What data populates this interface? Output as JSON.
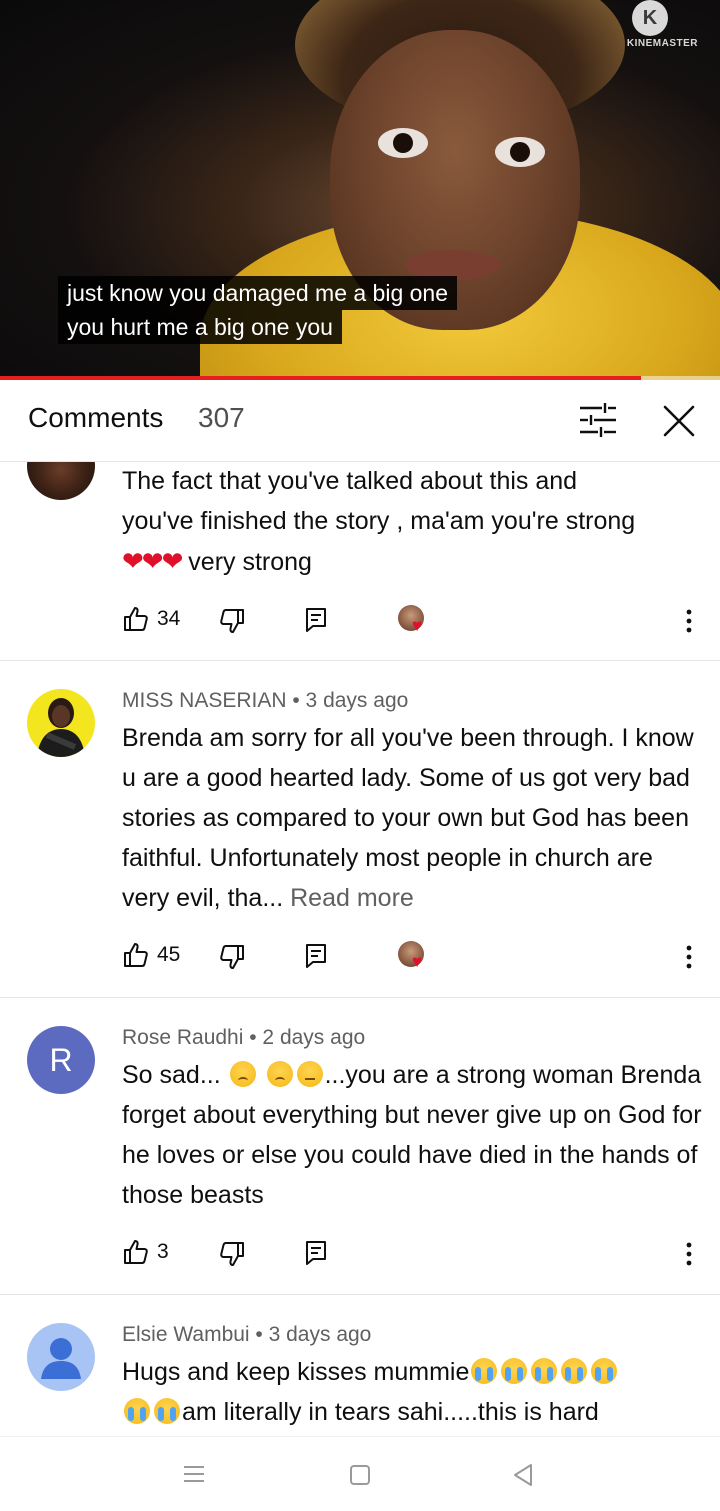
{
  "video": {
    "watermark_text": "KINEMASTER",
    "watermark_logo": "K",
    "caption_line1": "just know you damaged me a big one",
    "caption_line2": "you hurt me a big one you",
    "progress_fraction": 0.89
  },
  "header": {
    "title": "Comments",
    "count": "307",
    "filter_icon": "sliders-icon",
    "close_icon": "close-icon"
  },
  "comments": [
    {
      "author_meta": "",
      "text_line1": "The fact that you've talked about this and",
      "text_line2": "you've finished the story , ma'am you're strong",
      "hearts": "❤❤❤",
      "text_tail": " very strong",
      "likes": "34",
      "creator_hearted": true
    },
    {
      "author_meta": "MISS NASERIAN • 3 days ago",
      "text": "Brenda am sorry for all you've been through. I know u are a good hearted lady. Some of us got very bad stories as compared to your own but God has been faithful. Unfortunately most people in church are very evil, tha...",
      "read_more": "Read more",
      "likes": "45",
      "creator_hearted": true
    },
    {
      "author_meta": "Rose Raudhi • 2 days ago",
      "avatar_letter": "R",
      "text_head": "So sad... ",
      "text_rest": "...you are a strong woman Brenda forget about everything but never give up on God for he loves or else you could have died in the hands of those beasts",
      "likes": "3",
      "creator_hearted": false
    },
    {
      "author_meta": "Elsie Wambui • 3 days ago",
      "text_head": "Hugs and keep kisses mummie",
      "text_rest": "am literally in tears sahi.....this is hard",
      "likes": "",
      "creator_hearted": false
    }
  ],
  "colors": {
    "accent_red": "#e61e1e",
    "heart_red": "#e0102b",
    "avatar_r_bg": "#5c6bc0",
    "avatar_default_bg": "#a7c4f5",
    "avatar_yellow_bg": "#f3e61f",
    "text_primary": "#0f0f0f",
    "text_secondary": "#606060"
  }
}
